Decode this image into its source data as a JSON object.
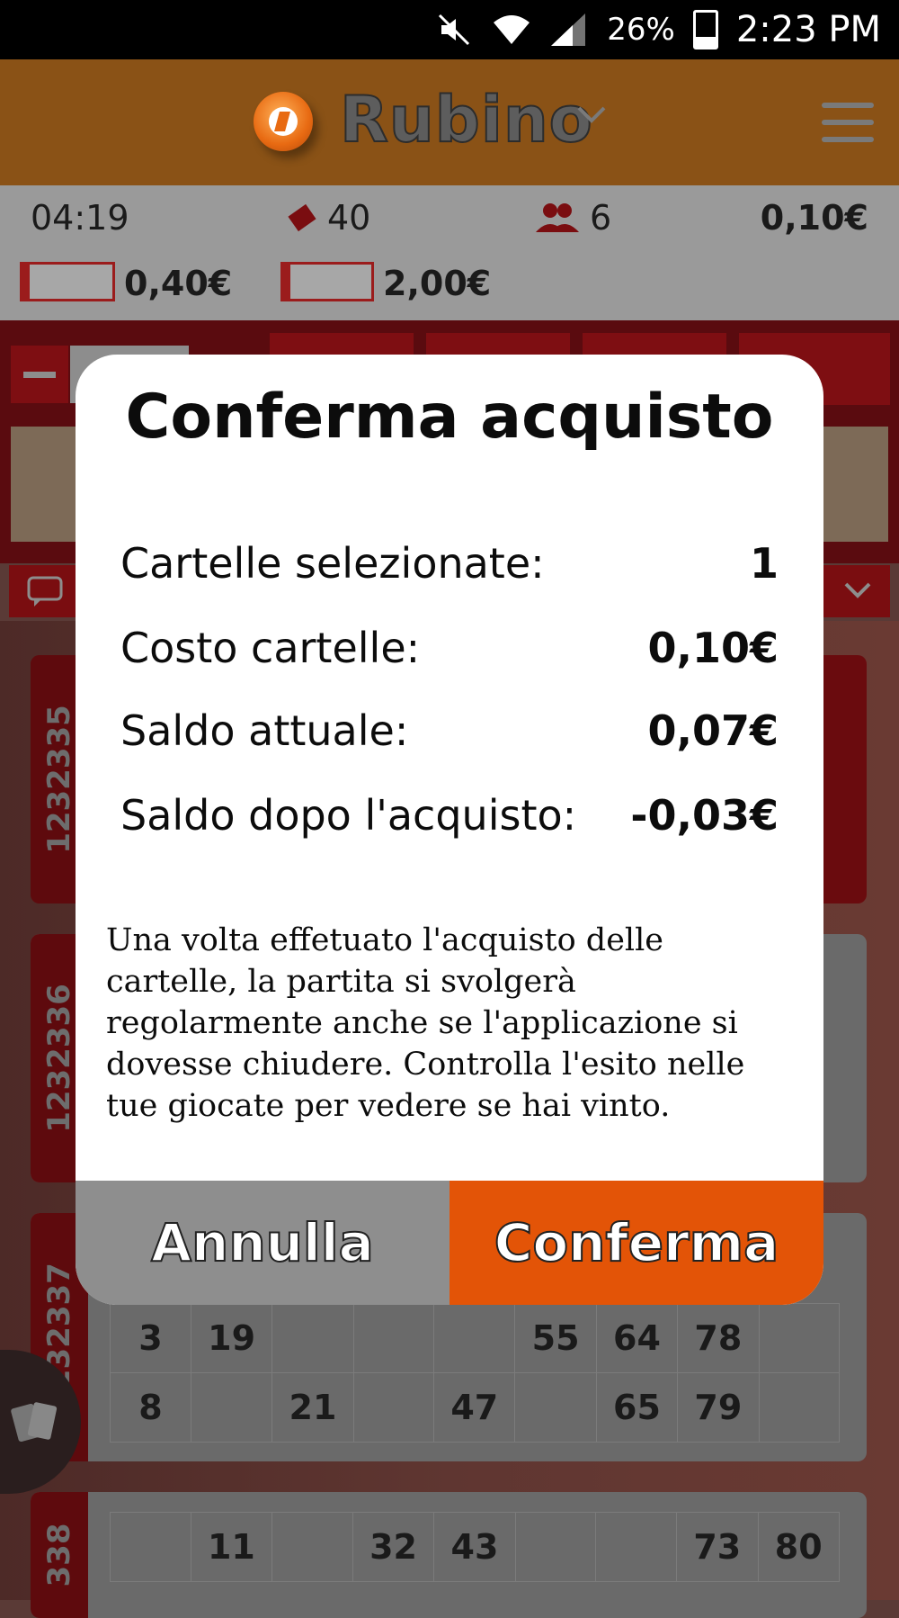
{
  "status_bar": {
    "battery": "26%",
    "time": "2:23 PM"
  },
  "app_bar": {
    "title": "Rubino"
  },
  "info": {
    "timer": "04:19",
    "tickets_count": "40",
    "players_count": "6",
    "ticket_price": "0,10€",
    "price_single": "0,40€",
    "price_multi": "2,00€"
  },
  "modal": {
    "title": "Conferma acquisto",
    "rows": [
      {
        "label": "Cartelle selezionate:",
        "value": "1"
      },
      {
        "label": "Costo cartelle:",
        "value": "0,10€"
      },
      {
        "label": "Saldo attuale:",
        "value": "0,07€"
      },
      {
        "label": "Saldo dopo l'acquisto:",
        "value": "-0,03€"
      }
    ],
    "note": "Una volta effetuato l'acquisto delle cartelle, la partita si svolgerà regolarmente anche se l'applicazione si dovesse chiudere. Controlla l'esito nelle tue giocate per vedere se hai vinto.",
    "cancel_label": "Annulla",
    "confirm_label": "Conferma"
  },
  "background": {
    "tickets": [
      {
        "id": "1232335"
      },
      {
        "id": "1232336"
      },
      {
        "id": "1232337",
        "rows": [
          [
            "3",
            "19",
            "",
            "",
            "",
            "55",
            "64",
            "78",
            ""
          ],
          [
            "8",
            "",
            "21",
            "",
            "47",
            "",
            "65",
            "79",
            ""
          ]
        ]
      },
      {
        "id": "338",
        "rows": [
          [
            "",
            "11",
            "",
            "32",
            "43",
            "",
            "",
            "73",
            "80"
          ]
        ]
      }
    ]
  },
  "colors": {
    "accent": "#e35407",
    "app_bar": "#8a5216"
  }
}
